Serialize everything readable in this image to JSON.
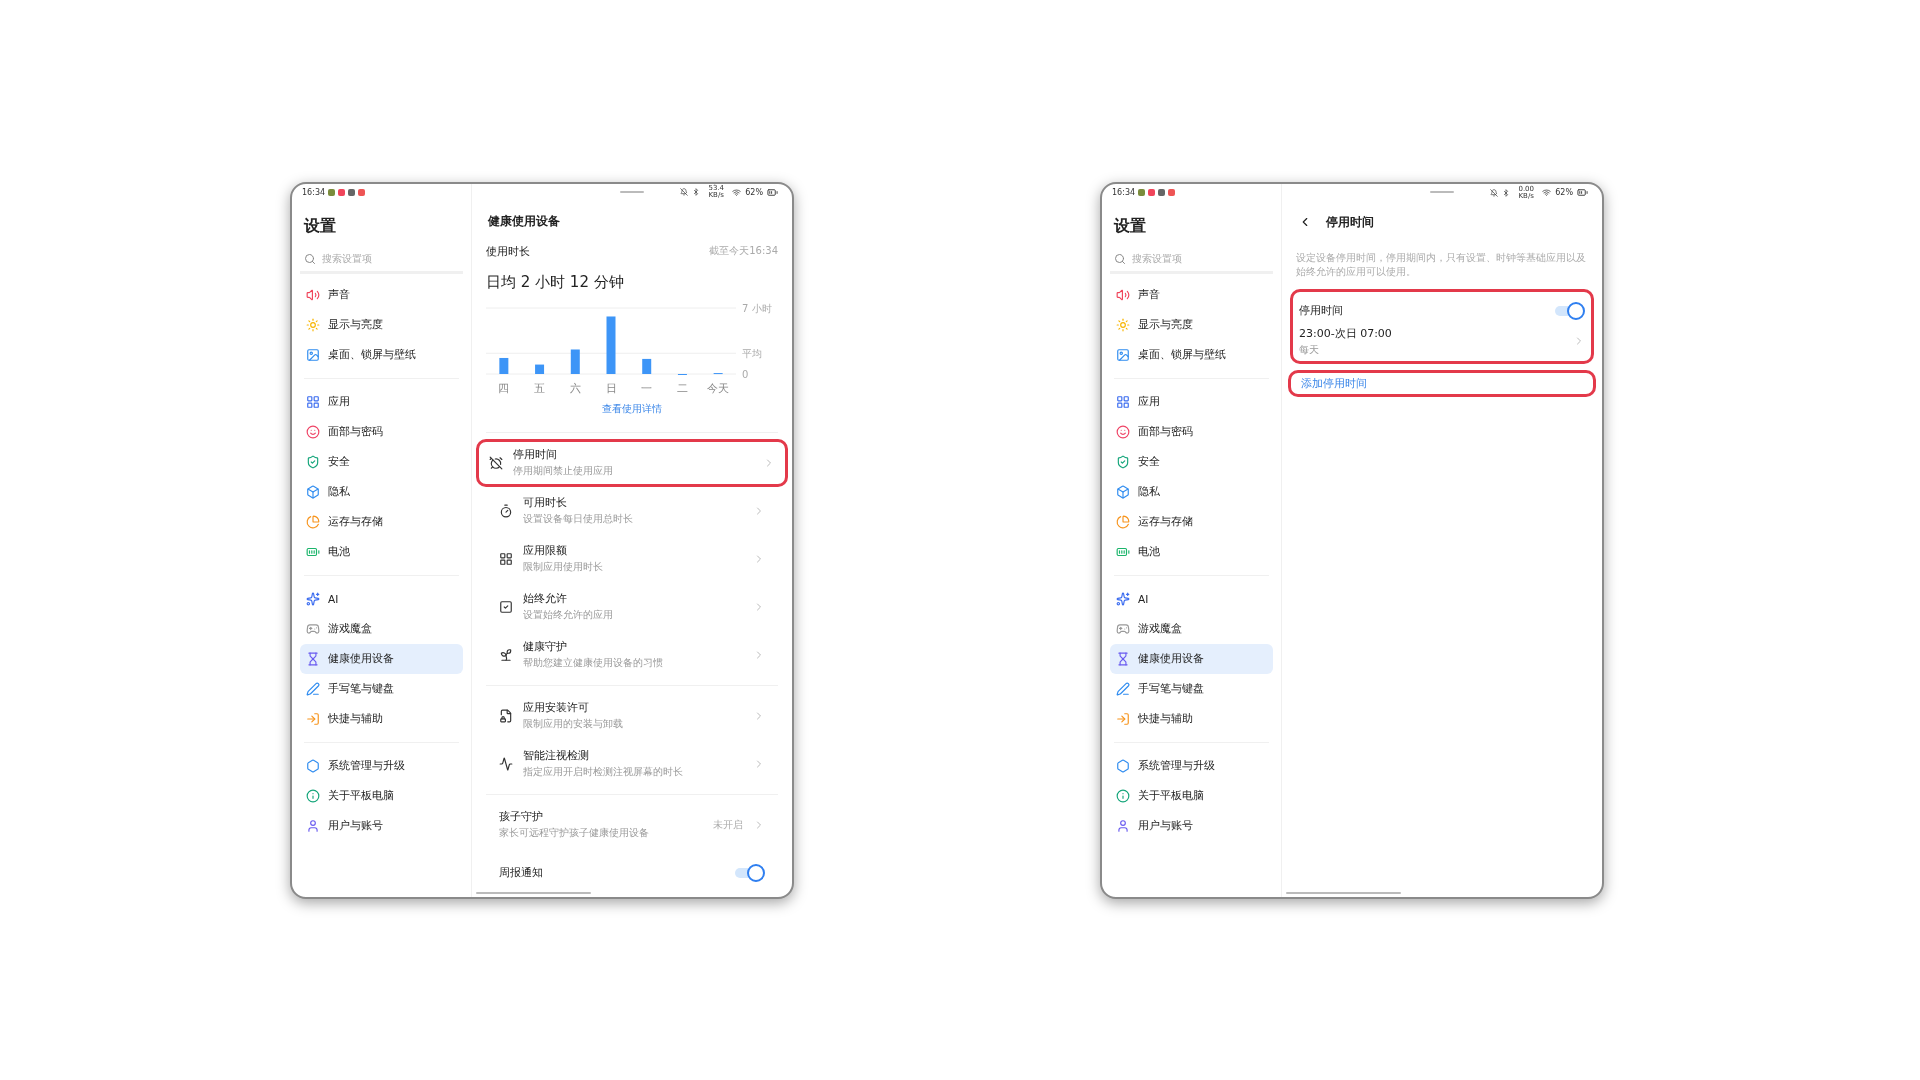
{
  "tablets": [
    {
      "status_bar": {
        "time": "16:34",
        "net_speed": "53.4 KB/s",
        "battery": "62%"
      },
      "sidebar": {
        "title": "设置",
        "search": {
          "placeholder": "搜索设置项"
        },
        "groups": [
          {
            "items": [
              {
                "label": "声音",
                "selected": false
              },
              {
                "label": "显示与亮度",
                "selected": false
              },
              {
                "label": "桌面、锁屏与壁纸",
                "selected": false
              }
            ]
          },
          {
            "items": [
              {
                "label": "应用",
                "selected": false
              },
              {
                "label": "面部与密码",
                "selected": false
              },
              {
                "label": "安全",
                "selected": false
              },
              {
                "label": "隐私",
                "selected": false
              },
              {
                "label": "运存与存储",
                "selected": false
              },
              {
                "label": "电池",
                "selected": false
              }
            ]
          },
          {
            "items": [
              {
                "label": "AI",
                "selected": false
              },
              {
                "label": "游戏魔盒",
                "selected": false
              },
              {
                "label": "健康使用设备",
                "selected": true
              },
              {
                "label": "手写笔与键盘",
                "selected": false
              },
              {
                "label": "快捷与辅助",
                "selected": false
              }
            ]
          },
          {
            "items": [
              {
                "label": "系统管理与升级",
                "selected": false
              },
              {
                "label": "关于平板电脑",
                "selected": false
              },
              {
                "label": "用户与账号",
                "selected": false
              }
            ]
          }
        ]
      },
      "detail": {
        "kind": "health",
        "title": "健康使用设备",
        "usage": {
          "label": "使用时长",
          "as_of": "截至今天16:34",
          "average": "日均 2 小时 12 分钟",
          "chart_data": {
            "type": "bar",
            "categories": [
              "四",
              "五",
              "六",
              "日",
              "一",
              "二",
              "今天"
            ],
            "values": [
              1.7,
              1.0,
              2.6,
              6.1,
              1.6,
              0,
              0.1
            ],
            "ylim": [
              0,
              7
            ],
            "yticks": [
              {
                "value": 0,
                "label": "0"
              },
              {
                "value": 2.2,
                "label": "平均"
              },
              {
                "value": 7,
                "label": "7 小时"
              }
            ]
          },
          "details_link": "查看使用详情"
        },
        "sections": [
          {
            "rows": [
              {
                "kind": "nav",
                "title": "停用时间",
                "subtitle": "停用期间禁止使用应用",
                "highlighted": true
              },
              {
                "kind": "nav",
                "title": "可用时长",
                "subtitle": "设置设备每日使用总时长",
                "highlighted": false
              },
              {
                "kind": "nav",
                "title": "应用限额",
                "subtitle": "限制应用使用时长",
                "highlighted": false
              },
              {
                "kind": "nav",
                "title": "始终允许",
                "subtitle": "设置始终允许的应用",
                "highlighted": false
              },
              {
                "kind": "nav",
                "title": "健康守护",
                "subtitle": "帮助您建立健康使用设备的习惯",
                "highlighted": false
              }
            ]
          },
          {
            "rows": [
              {
                "kind": "nav",
                "title": "应用安装许可",
                "subtitle": "限制应用的安装与卸载",
                "highlighted": false
              },
              {
                "kind": "nav",
                "title": "智能注视检测",
                "subtitle": "指定应用开启时检测注视屏幕的时长",
                "highlighted": false
              }
            ]
          },
          {
            "rows": [
              {
                "kind": "value",
                "title": "孩子守护",
                "subtitle": "家长可远程守护孩子健康使用设备",
                "value": "未开启"
              },
              {
                "kind": "toggle",
                "title": "周报通知",
                "on": true
              }
            ]
          }
        ]
      }
    },
    {
      "status_bar": {
        "time": "16:34",
        "net_speed": "0.00 KB/s",
        "battery": "62%"
      },
      "sidebar": {
        "title": "设置",
        "search": {
          "placeholder": "搜索设置项"
        },
        "groups": [
          {
            "items": [
              {
                "label": "声音",
                "selected": false
              },
              {
                "label": "显示与亮度",
                "selected": false
              },
              {
                "label": "桌面、锁屏与壁纸",
                "selected": false
              }
            ]
          },
          {
            "items": [
              {
                "label": "应用",
                "selected": false
              },
              {
                "label": "面部与密码",
                "selected": false
              },
              {
                "label": "安全",
                "selected": false
              },
              {
                "label": "隐私",
                "selected": false
              },
              {
                "label": "运存与存储",
                "selected": false
              },
              {
                "label": "电池",
                "selected": false
              }
            ]
          },
          {
            "items": [
              {
                "label": "AI",
                "selected": false
              },
              {
                "label": "游戏魔盒",
                "selected": false
              },
              {
                "label": "健康使用设备",
                "selected": true
              },
              {
                "label": "手写笔与键盘",
                "selected": false
              },
              {
                "label": "快捷与辅助",
                "selected": false
              }
            ]
          },
          {
            "items": [
              {
                "label": "系统管理与升级",
                "selected": false
              },
              {
                "label": "关于平板电脑",
                "selected": false
              },
              {
                "label": "用户与账号",
                "selected": false
              }
            ]
          }
        ]
      },
      "detail": {
        "kind": "downtime",
        "title": "停用时间",
        "description": "设定设备停用时间，停用期间内，只有设置、时钟等基础应用以及始终允许的应用可以使用。",
        "schedule_card": {
          "highlighted": true,
          "toggle": {
            "label": "停用时间",
            "on": true
          },
          "schedule": {
            "time": "23:00-次日 07:00",
            "repeat": "每天"
          }
        },
        "add_link": {
          "label": "添加停用时间",
          "highlighted": true
        }
      }
    }
  ]
}
